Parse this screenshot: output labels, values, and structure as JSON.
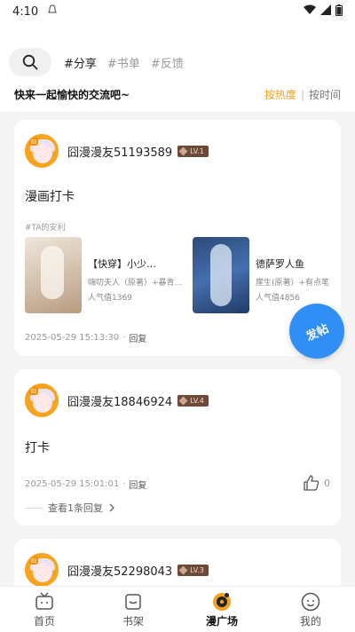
{
  "status_bar": {
    "time": "4:10"
  },
  "header": {
    "tags": [
      {
        "label": "#分享",
        "active": true
      },
      {
        "label": "#书单",
        "active": false
      },
      {
        "label": "#反馈",
        "active": false
      }
    ],
    "slogan": "快来一起愉快的交流吧~",
    "sort": {
      "hot": "按热度",
      "separator": "|",
      "time": "按时间"
    }
  },
  "posts": [
    {
      "username": "囧漫漫友51193589",
      "level": "LV.1",
      "text": "漫画打卡",
      "topic": "#TA的安利",
      "books": [
        {
          "title": "【快穿】小少…",
          "author": "嗨叨夫人（原著）+暴青…",
          "popularity": "人气值1369"
        },
        {
          "title": "德萨罗人鱼",
          "author": "崖生(原著）+有点笔",
          "popularity": "人气值4856"
        }
      ],
      "timestamp": "2025-05-29 15:13:30",
      "reply_label": "回复"
    },
    {
      "username": "囧漫漫友18846924",
      "level": "LV.4",
      "text": "打卡",
      "timestamp": "2025-05-29 15:01:01",
      "reply_label": "回复",
      "likes": "0",
      "view_replies": "查看1条回复"
    },
    {
      "username": "囧漫漫友52298043",
      "level": "LV.3"
    }
  ],
  "fab": {
    "label": "发帖"
  },
  "bottom_nav": [
    {
      "label": "首页",
      "icon": "tv-icon",
      "active": false
    },
    {
      "label": "书架",
      "icon": "bookshelf-icon",
      "active": false
    },
    {
      "label": "漫广场",
      "icon": "plaza-icon",
      "active": true
    },
    {
      "label": "我的",
      "icon": "profile-icon",
      "active": false
    }
  ],
  "colors": {
    "accent": "#f4a020",
    "fab": "#2f8ff5",
    "background": "#f4f4f4"
  }
}
